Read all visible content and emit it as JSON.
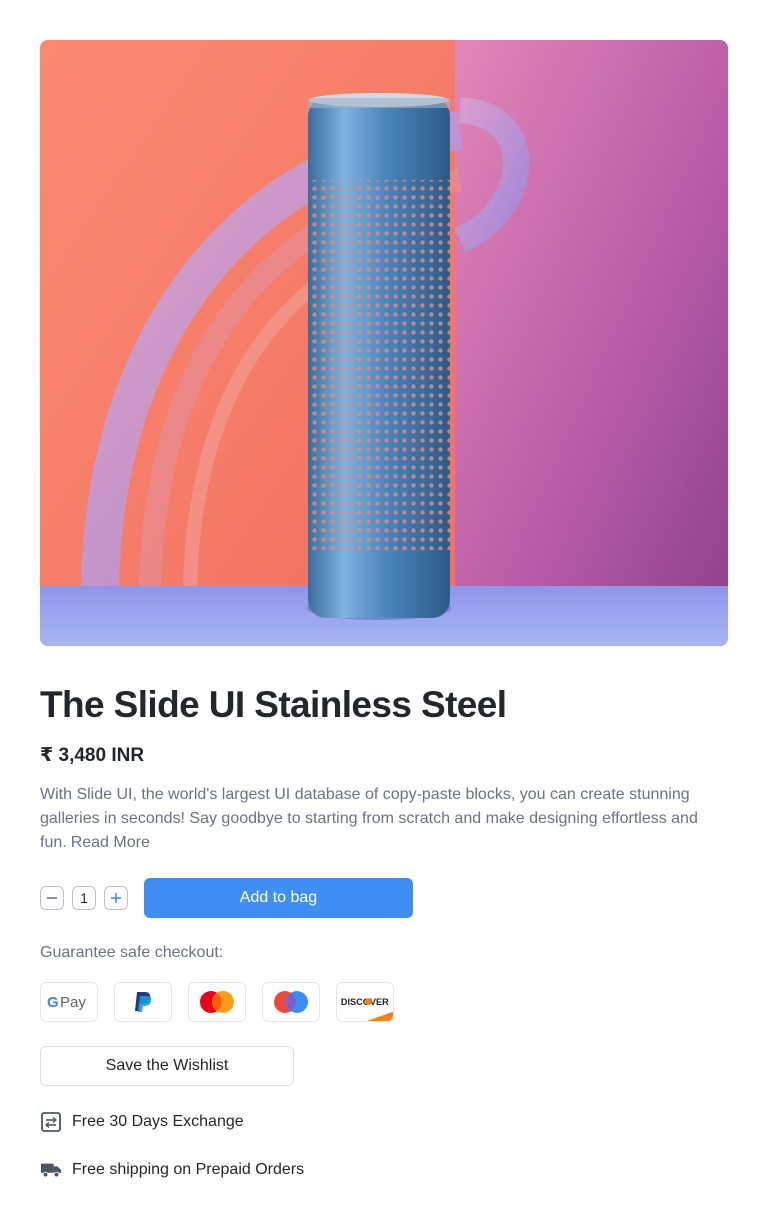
{
  "product": {
    "image_alt": "stainless-steel-speaker-image",
    "title": "The Slide UI Stainless Steel",
    "price": "₹ 3,480 INR",
    "description": "With Slide UI, the world's largest UI database of copy-paste blocks, you can create stunning galleries in seconds! Say goodbye to starting from scratch and make designing effortless and fun.",
    "read_more": "Read More"
  },
  "quantity": {
    "value": "1",
    "decrement_icon": "minus-icon",
    "increment_icon": "plus-icon"
  },
  "actions": {
    "add_to_bag": "Add to bag",
    "save_wishlist": "Save the Wishlist"
  },
  "checkout": {
    "label": "Guarantee safe checkout:",
    "methods": [
      {
        "name": "Google Pay",
        "icon": "gpay-icon"
      },
      {
        "name": "PayPal",
        "icon": "paypal-icon"
      },
      {
        "name": "Mastercard",
        "icon": "mastercard-icon"
      },
      {
        "name": "Maestro",
        "icon": "maestro-icon"
      },
      {
        "name": "DISCOVER",
        "icon": "discover-icon"
      }
    ]
  },
  "features": [
    {
      "text": "Free 30 Days Exchange",
      "icon": "exchange-icon"
    },
    {
      "text": "Free shipping on Prepaid Orders",
      "icon": "truck-icon"
    }
  ],
  "colors": {
    "accent": "#3f8ff2",
    "text_primary": "#23272b",
    "text_muted": "#6b7280"
  }
}
